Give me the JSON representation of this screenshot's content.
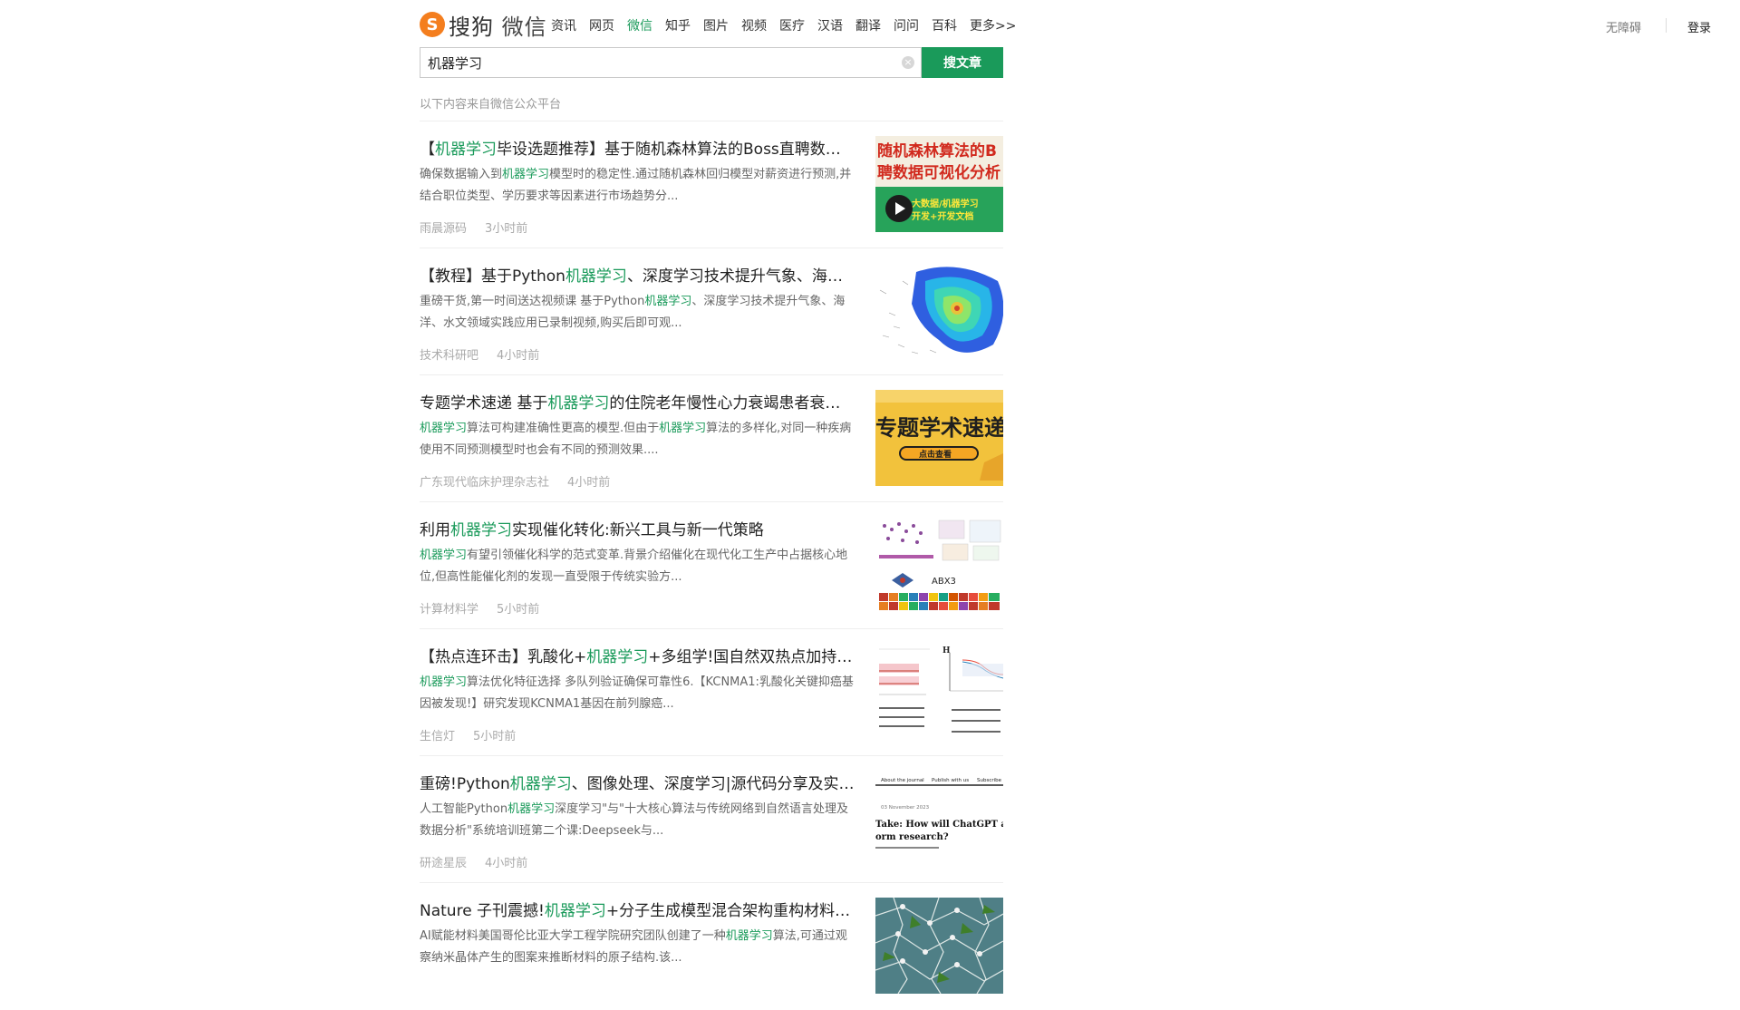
{
  "logo": {
    "mark": "S",
    "brand": "搜狗",
    "product": "微信"
  },
  "nav": [
    "资讯",
    "网页",
    "微信",
    "知乎",
    "图片",
    "视频",
    "医疗",
    "汉语",
    "翻译",
    "问问",
    "百科",
    "更多>>"
  ],
  "nav_active_index": 2,
  "header_right": {
    "accessibility": "无障碍",
    "login": "登录"
  },
  "search": {
    "query": "机器学习",
    "button": "搜文章"
  },
  "source_note": "以下内容来自微信公众平台",
  "results": [
    {
      "title_parts": [
        "【",
        "机器学习",
        "毕设选题推荐】基于随机森林算法的Boss直聘数据可视化分析系统..."
      ],
      "desc_parts": [
        "确保数据输入到",
        "机器学习",
        "模型时的稳定性.通过随机森林回归模型对薪资进行预测,并结合职位类型、学历要求等因素进行市场趋势分..."
      ],
      "source": "雨晨源码",
      "time": "3小时前",
      "thumb_text": [
        "随机森林算法的B",
        "聘数据可视化分析",
        "大数据/机器学习",
        "开发+开发文档"
      ]
    },
    {
      "title_parts": [
        "【教程】基于Python",
        "机器学习",
        "、深度学习技术提升气象、海洋、水文领域实践..."
      ],
      "desc_parts": [
        "重磅干货,第一时间送达视频课 基于Python",
        "机器学习",
        "、深度学习技术提升气象、海洋、水文领域实践应用已录制视频,购买后即可观..."
      ],
      "source": "技术科研吧",
      "time": "4小时前"
    },
    {
      "title_parts": [
        "专题学术速递 基于",
        "机器学习",
        "的住院老年慢性心力衰竭患者衰弱风险预测模型..."
      ],
      "desc_parts": [
        "",
        "机器学习",
        "算法可构建准确性更高的模型.但由于",
        "机器学习",
        "算法的多样化,对同一种疾病使用不同预测模型时也会有不同的预测效果...."
      ],
      "source": "广东现代临床护理杂志社",
      "time": "4小时前",
      "thumb_text": [
        "专题学术速递",
        "点击查看"
      ]
    },
    {
      "title_parts": [
        "利用",
        "机器学习",
        "实现催化转化:新兴工具与新一代策略"
      ],
      "desc_parts": [
        "",
        "机器学习",
        "有望引领催化科学的范式变革.背景介绍催化在现代化工生产中占据核心地位,但高性能催化剂的发现一直受限于传统实验方..."
      ],
      "source": "计算材料学",
      "time": "5小时前",
      "thumb_text": [
        "ABX3"
      ]
    },
    {
      "title_parts": [
        "【热点连环击】乳酸化+",
        "机器学习",
        "+多组学!国自然双热点加持,发表于SCI一区..."
      ],
      "desc_parts": [
        "",
        "机器学习",
        "算法优化特征选择 多队列验证确保可靠性6.【KCNMA1:乳酸化关键抑癌基因被发现!】研究发现KCNMA1基因在前列腺癌..."
      ],
      "source": "生信灯",
      "time": "5小时前"
    },
    {
      "title_parts": [
        "重磅!Python",
        "机器学习",
        "、图像处理、深度学习|源代码分享及实战应用..."
      ],
      "desc_parts": [
        "人工智能Python",
        "机器学习",
        "深度学习\"与\"十大核心算法与传统网络到自然语言处理及数据分析\"系统培训班第二个课:Deepseek与..."
      ],
      "source": "研途星辰",
      "time": "4小时前",
      "thumb_text": [
        "About the journal",
        "Publish with us",
        "Subscribe",
        "03 November 2023",
        "Take: How will ChatGPT and g",
        "orm research?"
      ]
    },
    {
      "title_parts": [
        "Nature 子刊震撼!",
        "机器学习",
        "+分子生成模型混合架构重构材料发现范式..."
      ],
      "desc_parts": [
        "AI赋能材料美国哥伦比亚大学工程学院研究团队创建了一种",
        "机器学习",
        "算法,可通过观察纳米晶体产生的图案来推断材料的原子结构.该..."
      ],
      "source": "",
      "time": ""
    }
  ]
}
